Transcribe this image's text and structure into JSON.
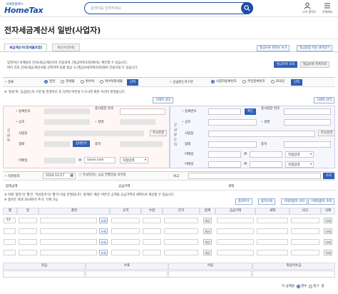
{
  "header": {
    "logo_sub": "국세청홈택스",
    "logo": "HomeTax",
    "search_placeholder": "검색어를 입력하세요",
    "user_label": "나의 홈택스",
    "menu_label": "전체메뉴"
  },
  "page": {
    "title": "전자세금계산서 일반(사업자)",
    "tabs": [
      "세금계산서(영세율포함)",
      "계산서(면세)"
    ],
    "top_buttons": [
      "발급보류 화면보 보기",
      "발급방법 작성 내려받기"
    ],
    "info_lines": [
      "입력하신 이메일로 전자(세금)계산서가 전송되며, [발급목록조회]에서도 확인할 수 있습니다.",
      "여러 건의 전자(세금)계산서를 선택하여 일괄 발급 시 [발급보류목록조회]에서 전송하실 수 있습니다."
    ],
    "info_buttons": [
      "발급목록 조회",
      "발급보류 목록조회"
    ]
  },
  "type_row": {
    "label": "종류",
    "options": [
      "일반",
      "영세율",
      "위수탁",
      "위수탁영세율"
    ],
    "selected": 0,
    "select_label": "선택",
    "id_type_label": "공급받는자구분",
    "id_options": [
      "사업자등록번호",
      "주민등록번호",
      "외국인"
    ],
    "id_selected": 0,
    "id_select_label": "선택"
  },
  "note": "※ '종류'와 '공급받는자 구분'을 변경하신 후 [선택] 버튼을 누르시면 화면 서식이 변경됩니다.",
  "corp_buttons": [
    "거래처 관리",
    "거래처 관리"
  ],
  "supplier": {
    "side_label": "공급자",
    "reg_no": "등록번호",
    "branch_no": "종사업장 번호",
    "company": "상호",
    "name": "성명",
    "address": "사업장",
    "addr_btn": "주소변경",
    "biz_type": "업태",
    "biz_btn": "업태변경",
    "biz_item": "종목",
    "email": "이메일",
    "email_domain": "naver.com",
    "email_select": "직접입력"
  },
  "buyer": {
    "side_label": "공급받는자",
    "reg_no": "등록번호",
    "check_btn": "확인",
    "branch_no": "종사업장 번호",
    "company": "상호",
    "name": "성명",
    "address": "사업장",
    "addr_btn": "주소검색",
    "biz_type": "업태",
    "biz_item": "종목",
    "email1": "이메일",
    "email2": "이메일",
    "email_select": "직접입력"
  },
  "date_row": {
    "label": "작성일자",
    "value": "2024-12-17",
    "hint": "작성일자는 공급 연월일을 의미함",
    "note_label": "비고",
    "note_btn": "조회"
  },
  "totals_row": {
    "total_label": "합계금액",
    "supply_label": "공급가액",
    "tax_label": "세액"
  },
  "notes2": [
    "※ 아래 '품목'의 '월'은 '작성일자'의 '월'이 자동 반영됩니다. 합계의 '계산' 버튼은 금액을 공급가액과 세액으로 계산할 수 있습니다.",
    "※ 품목은 최대 16개까지 추가, 삭제 가능"
  ],
  "item_buttons": [
    "품목추가",
    "품목삭제",
    "거래처품목 관리",
    "거래처품목 조회"
  ],
  "items": {
    "headers": [
      "월",
      "일",
      "품목",
      "규격",
      "수량",
      "단가",
      "합계",
      "공급가액",
      "세액",
      "비고",
      "삭제"
    ],
    "first_month": "12",
    "lookup_btn": "조회",
    "calc_btn": "계산",
    "delete_btn": "삭제",
    "rows": 4
  },
  "payment": {
    "headers": [
      "현금",
      "수표",
      "어음",
      "외상미수금"
    ]
  },
  "footer": {
    "label": "이 금액을",
    "options": [
      "영수",
      "청구"
    ],
    "selected": 0,
    "suffix": "함"
  }
}
